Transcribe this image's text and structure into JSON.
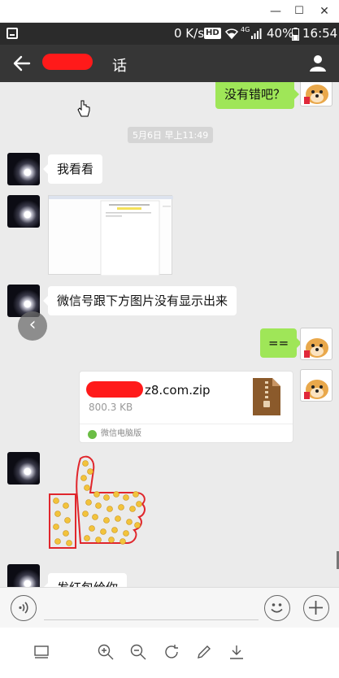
{
  "window": {
    "minimize_glyph": "—",
    "maximize_glyph": "☐",
    "close_glyph": "✕"
  },
  "status_bar": {
    "speed": "0 K/s",
    "hd_badge": "HD",
    "network_badge": "4G",
    "battery": "40%",
    "time": "16:54",
    "icons": [
      "screenshot-icon",
      "wifi-icon",
      "signal-icon",
      "battery-icon"
    ]
  },
  "app_bar": {
    "title_visible": "话",
    "icons": [
      "back-arrow-icon",
      "user-profile-icon"
    ]
  },
  "chat": {
    "timestamp": "5月6日 早上11:49",
    "messages": [
      {
        "side": "right",
        "type": "text",
        "text": "没有错吧？"
      },
      {
        "side": "left",
        "type": "text",
        "text": "我看看"
      },
      {
        "side": "left",
        "type": "image",
        "text": ""
      },
      {
        "side": "left",
        "type": "text",
        "text": "微信号跟下方图片没有显示出来"
      },
      {
        "side": "right",
        "type": "text",
        "text": "=="
      },
      {
        "side": "right",
        "type": "file",
        "file_name_visible": "z8.com.zip",
        "file_size": "800.3 KB",
        "source": "微信电脑版"
      },
      {
        "side": "left",
        "type": "sticker",
        "text": ""
      },
      {
        "side": "left",
        "type": "text",
        "text": "发红包给你"
      }
    ]
  },
  "input_bar": {
    "placeholder": "",
    "icons": [
      "voice-icon",
      "emoji-icon",
      "plus-icon"
    ]
  },
  "toolbar": {
    "icons": [
      "screen-icon",
      "zoom-in-icon",
      "zoom-out-icon",
      "rotate-icon",
      "edit-icon",
      "download-icon"
    ]
  },
  "colors": {
    "app_bar": "#363636",
    "status_bar": "#2b2b2b",
    "sent_bubble": "#9fe658",
    "chat_background": "#ebebeb",
    "redaction": "#ff1a1a"
  }
}
